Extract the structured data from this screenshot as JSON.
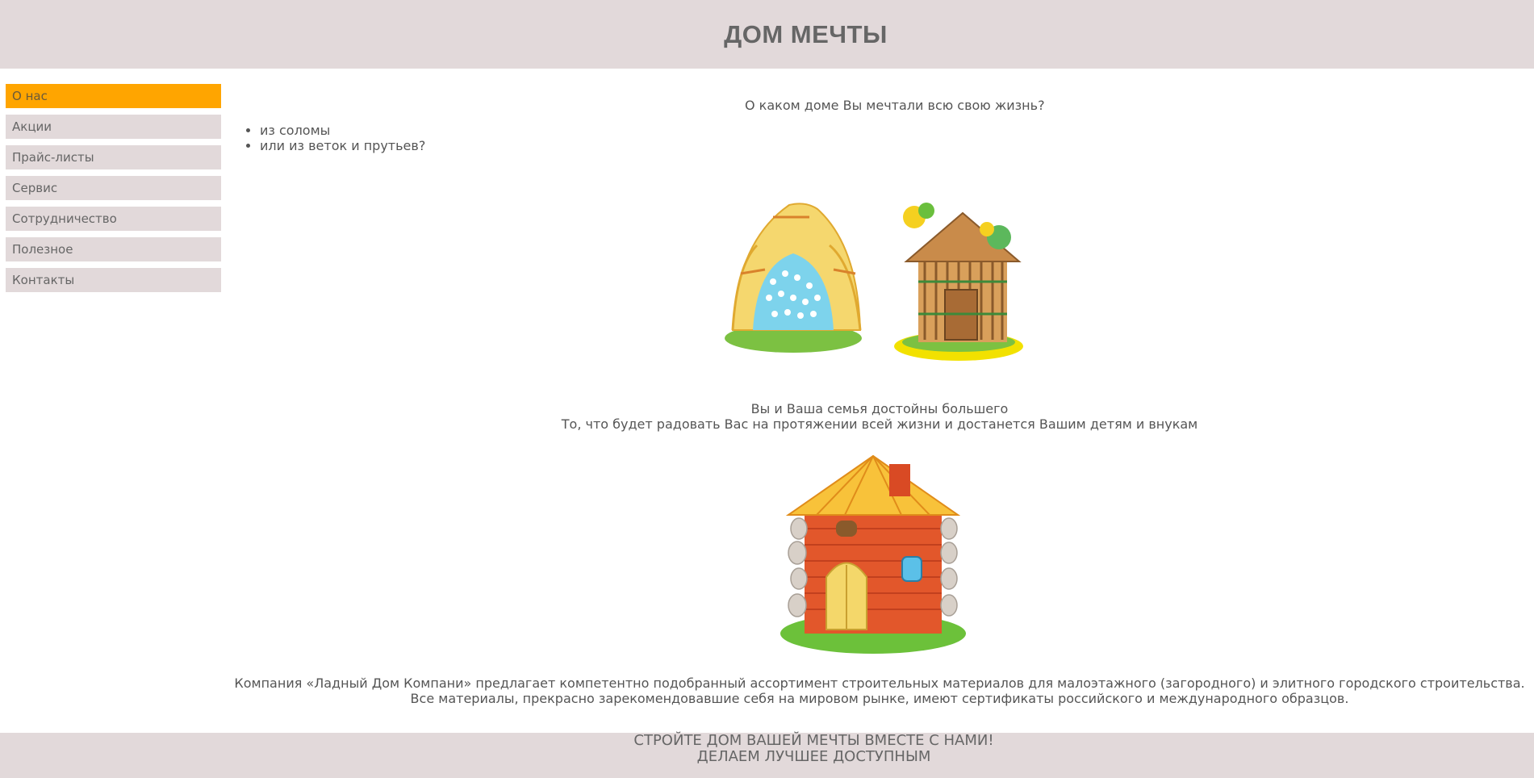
{
  "header": {
    "title": "ДОМ МЕЧТЫ"
  },
  "sidebar": {
    "items": [
      {
        "label": "О нас"
      },
      {
        "label": "Акции"
      },
      {
        "label": "Прайс-листы"
      },
      {
        "label": "Сервис"
      },
      {
        "label": "Сотрудничество"
      },
      {
        "label": "Полезное"
      },
      {
        "label": "Контакты"
      }
    ]
  },
  "main": {
    "question": "О каком доме Вы мечтали всю свою жизнь?",
    "options": [
      "из соломы",
      "или из веток и прутьев?"
    ],
    "subtitle_line1": "Вы и Ваша семья достойны большего",
    "subtitle_line2": "То, что будет радовать Вас на протяжении всей жизни и достанется Вашим детям и внукам",
    "company_text": "Компания «Ладный Дом Компани» предлагает компетентно подобранный ассортимент строительных материалов для малоэтажного (загородного) и элитного городского строительства. Все материалы, прекрасно зарекомендовавшие себя на мировом рынке, имеют сертификаты российского и международного образцов."
  },
  "footer": {
    "line1": "СТРОЙТЕ ДОМ ВАШЕЙ МЕЧТЫ ВМЕСТЕ С НАМИ!",
    "line2": "ДЕЛАЕМ ЛУЧШЕЕ ДОСТУПНЫМ"
  },
  "colors": {
    "header_bg": "#e2d9da",
    "active_item": "#ffa500",
    "text": "#555555"
  }
}
